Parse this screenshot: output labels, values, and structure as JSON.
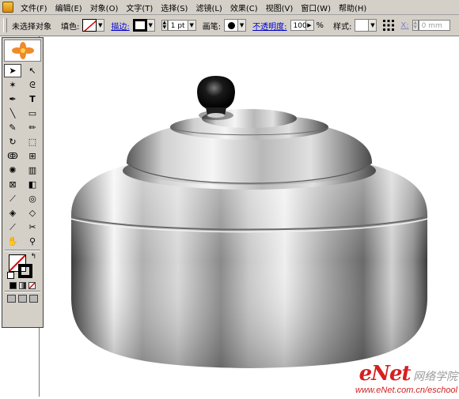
{
  "menu": {
    "items": [
      "文件(F)",
      "编辑(E)",
      "对象(O)",
      "文字(T)",
      "选择(S)",
      "滤镜(L)",
      "效果(C)",
      "视图(V)",
      "窗口(W)",
      "帮助(H)"
    ]
  },
  "control_bar": {
    "no_selection": "未选择对象",
    "fill_label": "填色:",
    "stroke_label": "描边:",
    "stroke_weight": "1 pt",
    "brush_label": "画笔:",
    "opacity_label": "不透明度:",
    "opacity_value": "100",
    "percent": "%",
    "style_label": "样式:",
    "x_label": "X:",
    "x_value": "0 mm"
  },
  "watermark": {
    "brand": "eNet",
    "chinese": "网络学院",
    "url": "www.eNet.com.cn/eschool"
  },
  "icons": [
    "app-icon",
    "selection-tool-icon",
    "direct-selection-tool-icon",
    "magic-wand-icon",
    "lasso-icon",
    "pen-icon",
    "type-icon",
    "line-icon",
    "rectangle-icon",
    "paintbrush-icon",
    "pencil-icon",
    "rotate-icon",
    "scale-icon",
    "warp-icon",
    "free-transform-icon",
    "symbol-sprayer-icon",
    "graph-icon",
    "mesh-icon",
    "gradient-icon",
    "eyedropper-icon",
    "blend-icon",
    "live-paint-icon",
    "live-paint-select-icon",
    "slice-icon",
    "scissors-icon",
    "hand-icon",
    "zoom-icon"
  ]
}
